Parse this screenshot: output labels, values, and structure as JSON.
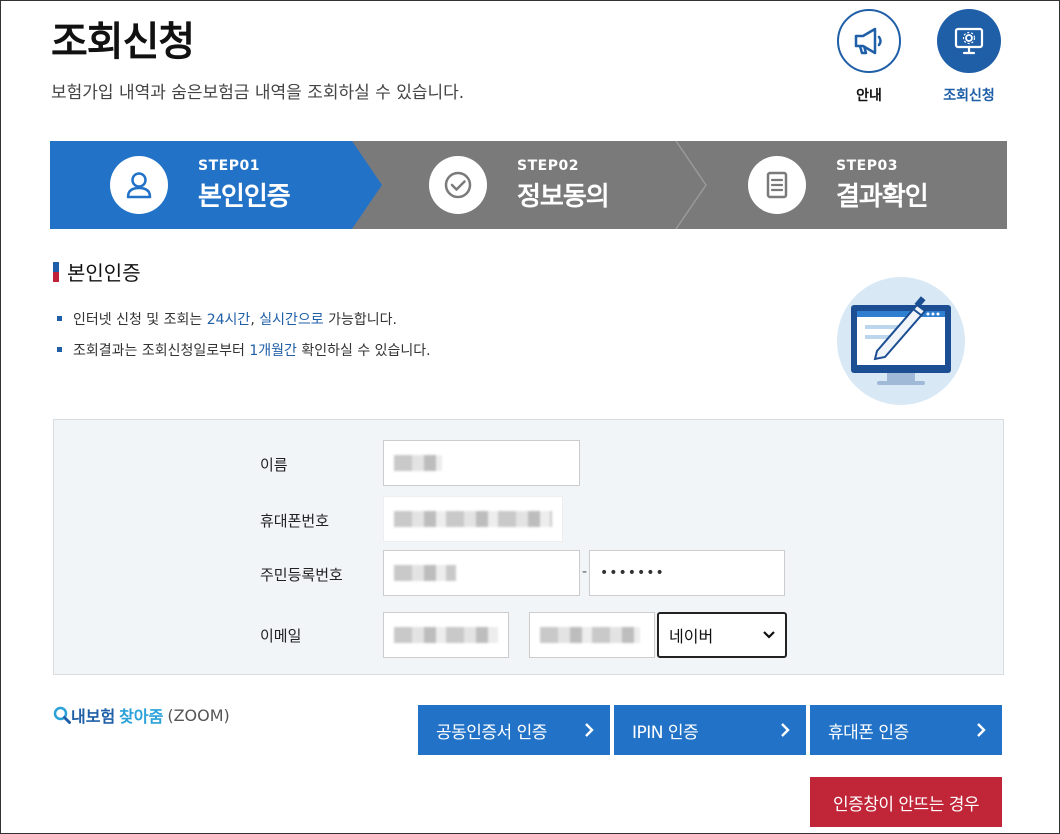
{
  "header": {
    "title": "조회신청",
    "description": "보험가입 내역과 숨은보험금 내역을 조회하실 수 있습니다."
  },
  "top_nav": [
    {
      "label": "안내",
      "icon": "megaphone-icon"
    },
    {
      "label": "조회신청",
      "icon": "monitor-gear-icon",
      "active": true
    }
  ],
  "steps": [
    {
      "num": "STEP01",
      "label": "본인인증",
      "icon": "user-icon",
      "active": true
    },
    {
      "num": "STEP02",
      "label": "정보동의",
      "icon": "check-circle-icon"
    },
    {
      "num": "STEP03",
      "label": "결과확인",
      "icon": "document-icon"
    }
  ],
  "section": {
    "title": "본인인증",
    "notes": [
      {
        "pre": "인터넷 신청 및 조회는 ",
        "hl1": "24시간",
        "mid": ", ",
        "hl2": "실시간으로",
        "post": " 가능합니다."
      },
      {
        "pre": "조회결과는 조회신청일로부터 ",
        "hl1": "1개월간",
        "post": " 확인하실 수 있습니다."
      }
    ]
  },
  "form": {
    "name_label": "이름",
    "phone_label": "휴대폰번호",
    "rrn_label": "주민등록번호",
    "rrn_dash": "-",
    "rrn_back_value": "•••••••",
    "email_label": "이메일",
    "email_domain_selected": "네이버"
  },
  "zoom_logo": {
    "part1": "내보험",
    "part2": "찾아줌",
    "part3": "(ZOOM)"
  },
  "buttons": {
    "cert": "공동인증서 인증",
    "ipin": "IPIN 인증",
    "phone": "휴대폰 인증",
    "help": "인증창이 안뜨는 경우"
  },
  "colors": {
    "primary": "#2273c8",
    "danger": "#c02538",
    "step_inactive": "#7a7a7a"
  }
}
